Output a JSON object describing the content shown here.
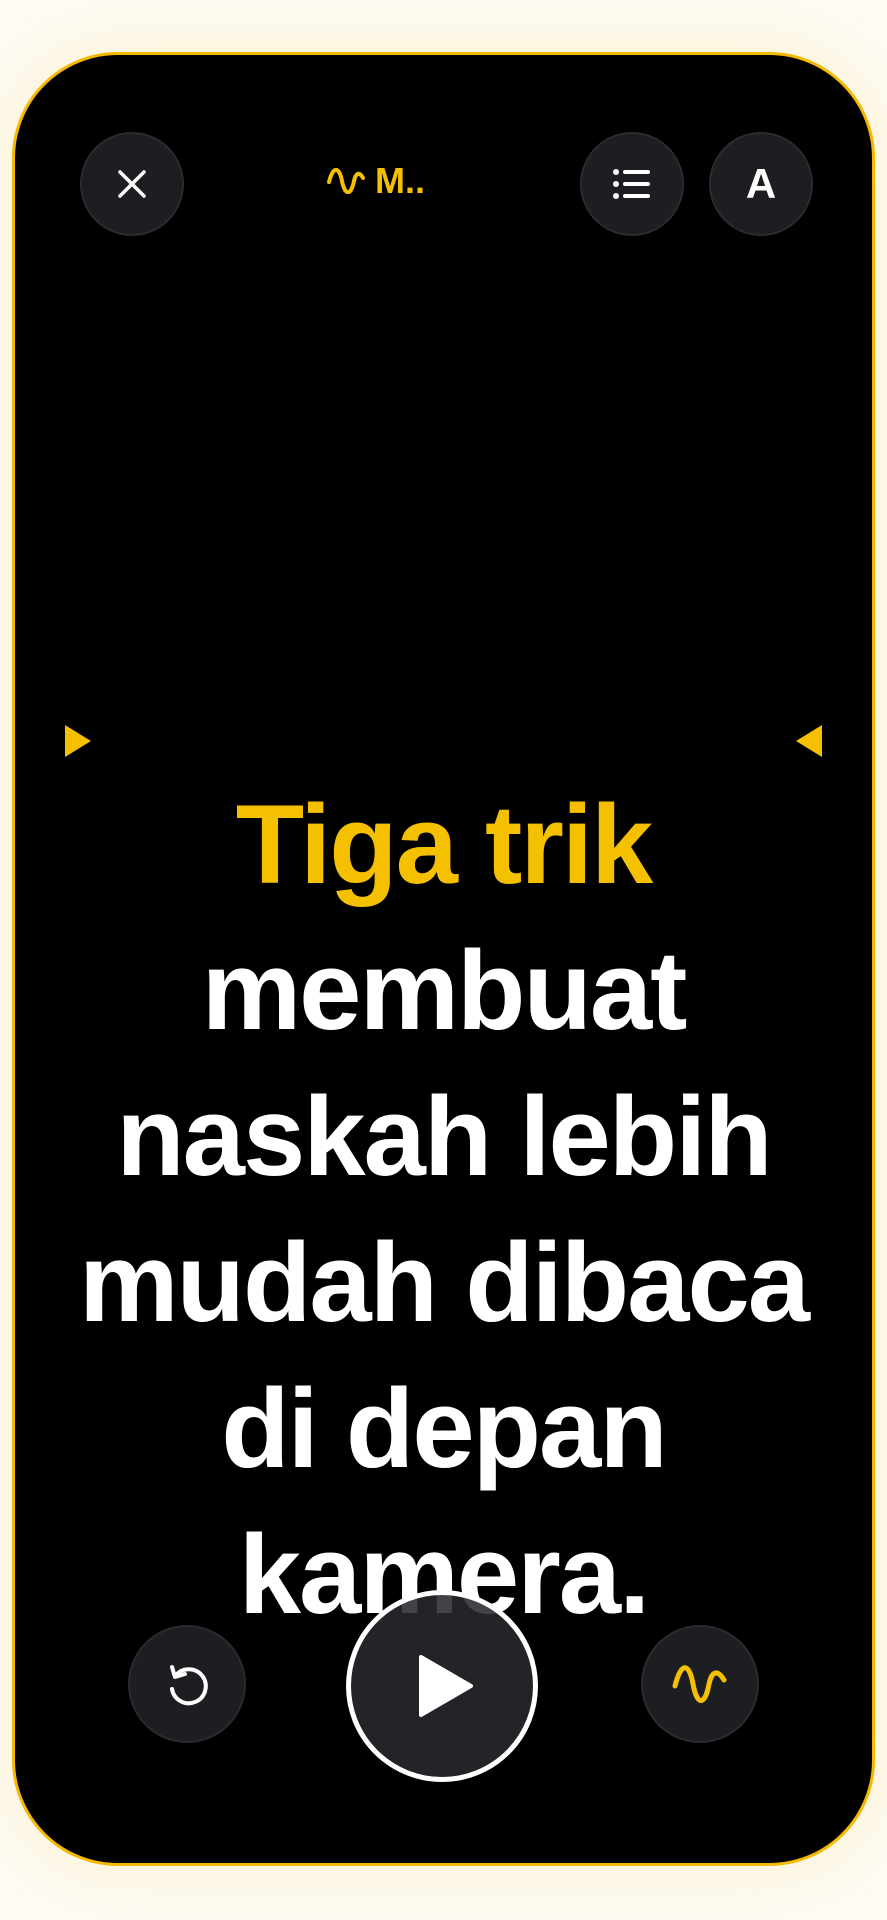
{
  "header": {
    "title": "M..",
    "close_icon": "close-icon",
    "list_icon": "list-icon",
    "font_label": "A"
  },
  "script": {
    "highlight": "Tiga trik",
    "rest": "membuat naskah lebih mudah dibaca di depan kamera."
  },
  "controls": {
    "reset_icon": "reset-icon",
    "play_icon": "play-icon",
    "wave_icon": "waveform-icon"
  },
  "colors": {
    "accent": "#f5c000",
    "background": "#000000",
    "button": "#1d1e21",
    "text": "#ffffff"
  }
}
